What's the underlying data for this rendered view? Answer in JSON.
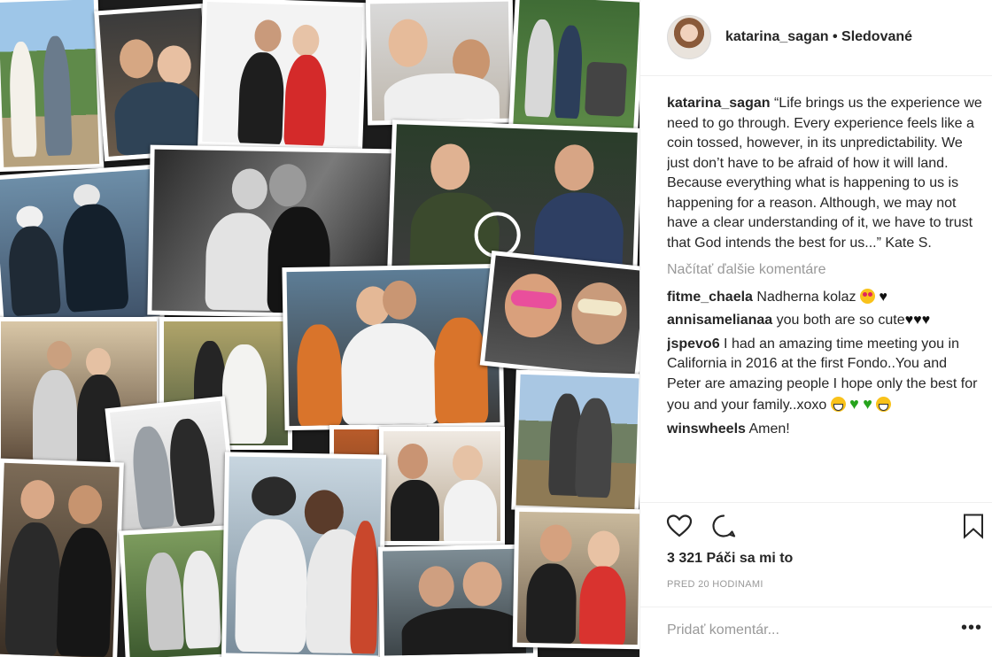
{
  "post": {
    "username": "katarina_sagan",
    "follow_status": "Sledované",
    "caption_user": "katarina_sagan",
    "caption_text": "“Life brings us the experience we need to go through. Every experience feels like a coin tossed, however, in its unpredictability. We just don’t have to be afraid of how it will land. Because everything what is happening to us is happening for a reason. Although, we may not have a clear understanding of it, we have to trust that God intends the best for us...” Kate S.",
    "load_more": "Načítať ďalšie komentáre",
    "likes": "3 321 Páči sa mi to",
    "time": "PRED 20 HODINAMI",
    "add_comment_placeholder": "Pridať komentár...",
    "more_label": "•••"
  },
  "comments": [
    {
      "user": "fitme_chaela",
      "text": "Nadherna kolaz"
    },
    {
      "user": "annisamelianaa",
      "text": "you both are so cute"
    },
    {
      "user": "jspevo6",
      "text": "I had an amazing time meeting you in California in 2016 at the first Fondo..You and Peter are amazing people I hope only the best for you and your family..xoxo"
    },
    {
      "user": "winswheels",
      "text": "Amen!"
    }
  ],
  "icons": {
    "like": "heart-outline-icon",
    "comment": "speech-bubble-icon",
    "save": "bookmark-icon"
  },
  "colors": {
    "text": "#262626",
    "muted": "#999999",
    "border": "#efefef",
    "green_heart": "#26a31c"
  }
}
